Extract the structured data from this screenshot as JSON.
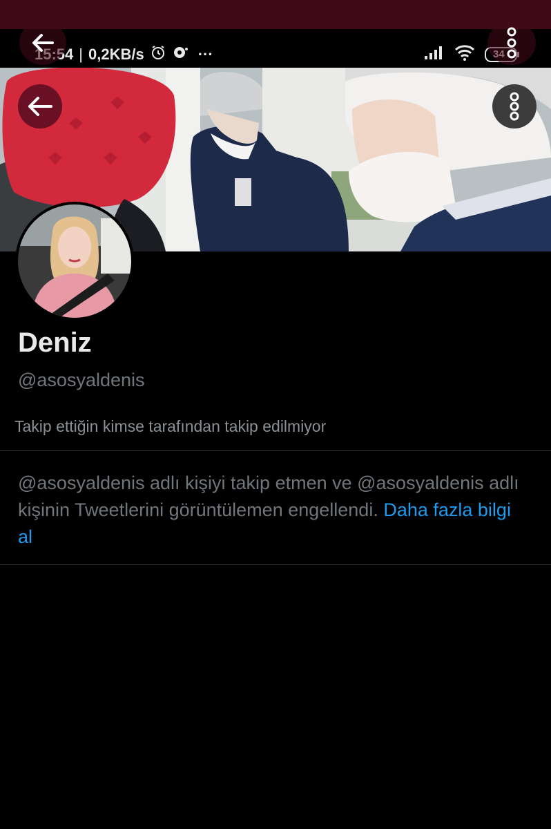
{
  "status_bar": {
    "time": "15:54",
    "speed": "0,2KB/s",
    "more": "···",
    "battery": "34",
    "icons": [
      "alarm-icon",
      "notification-icon",
      "signal-icon",
      "wifi-icon",
      "battery-icon"
    ]
  },
  "header": {
    "back_icon": "arrow-left-icon",
    "more_icon": "more-vertical-icon"
  },
  "profile": {
    "name": "Deniz",
    "handle": "@asosyaldenis",
    "follow_note": "Takip ettiğin kimse tarafından takip edilmiyor"
  },
  "blocked_notice": {
    "text": "@asosyaldenis adlı kişiyi takip etmen ve @asosyaldenis adlı kişinin Tweetlerini görüntülemen engellendi. ",
    "link": "Daha fazla bilgi al"
  },
  "colors": {
    "background": "#000000",
    "top_strip": "#3f0a16",
    "back_button": "#6a1024",
    "link": "#1d9bf0",
    "secondary_text": "#71767b"
  }
}
